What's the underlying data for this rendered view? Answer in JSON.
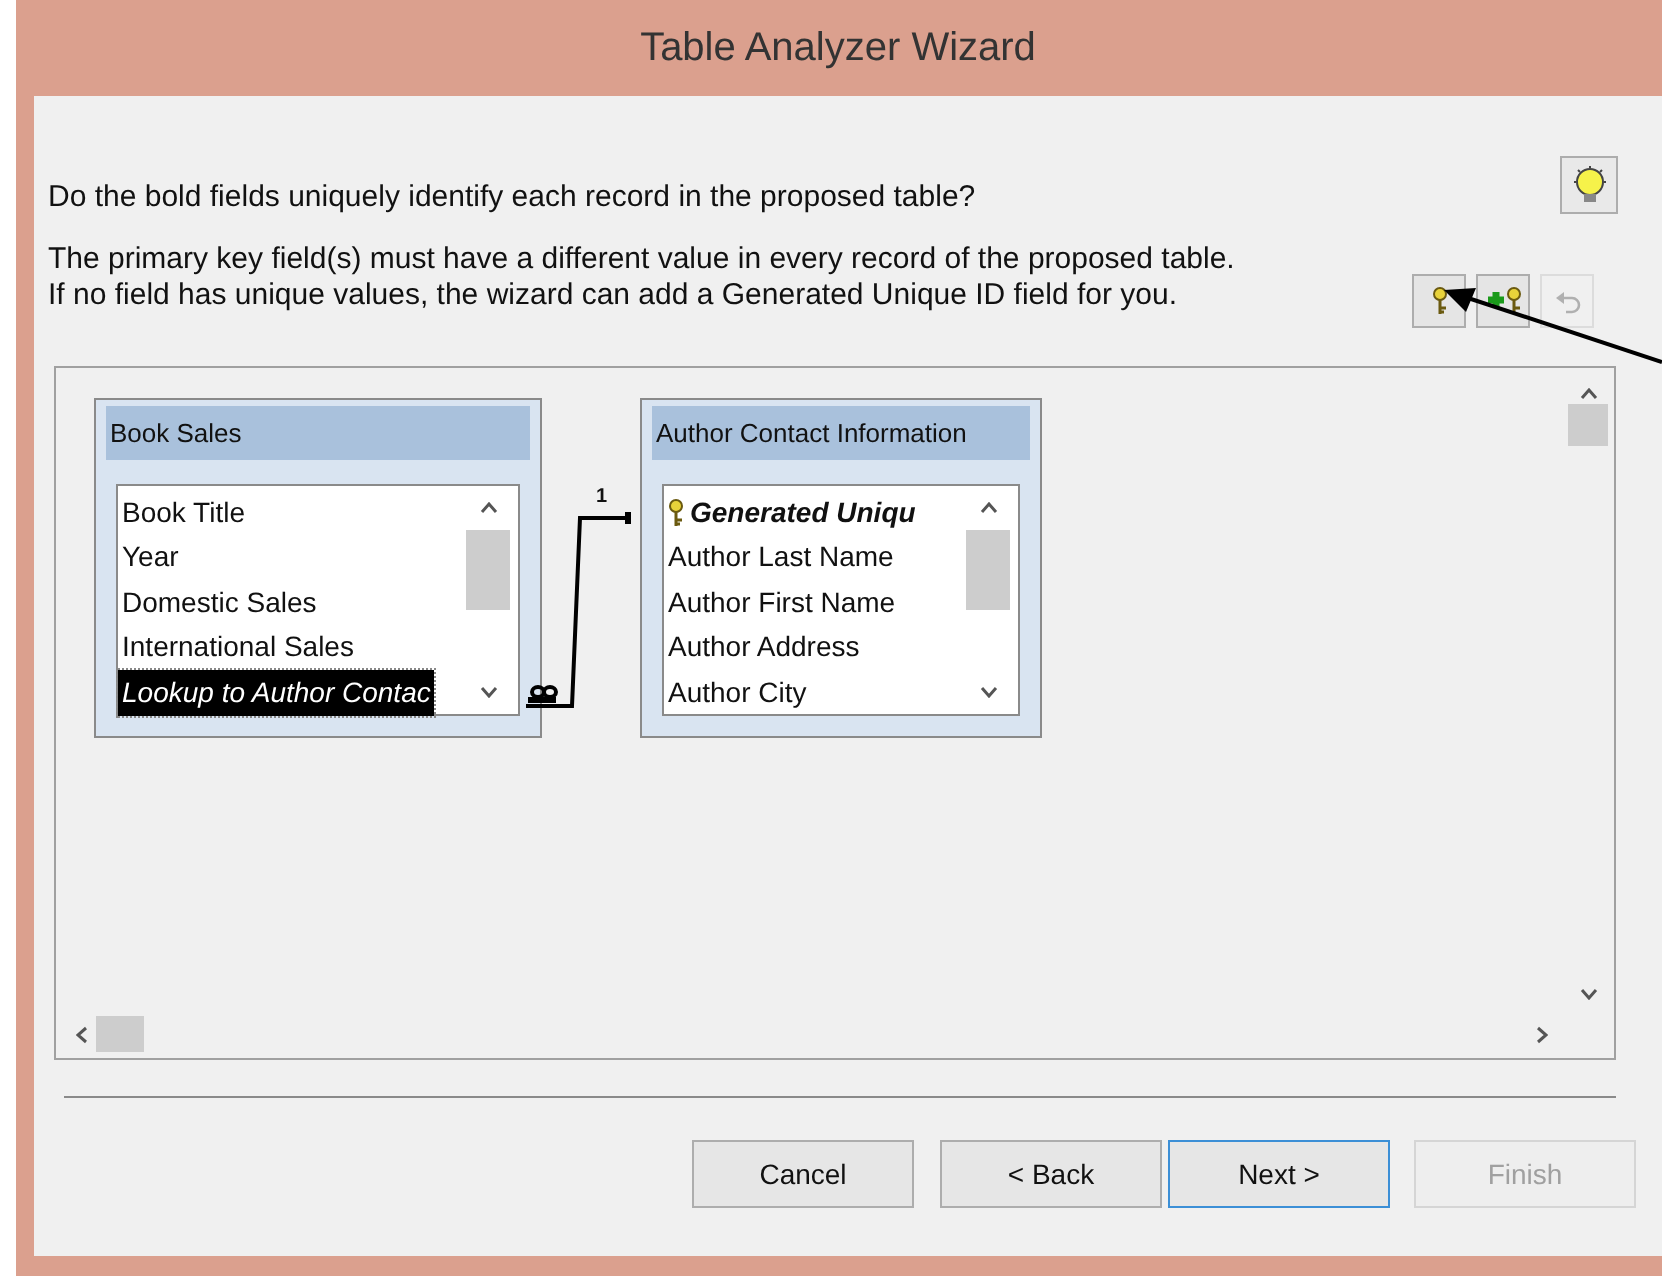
{
  "window": {
    "title": "Table Analyzer Wizard"
  },
  "prompt": {
    "question": "Do the bold fields uniquely identify each record in the proposed table?",
    "explanation": [
      "The primary key field(s) must have a different value in every record of the proposed table.",
      "If no field has unique values, the wizard can add a Generated Unique ID field for you."
    ]
  },
  "toolbar": [
    {
      "kind": "key",
      "disabled": false
    },
    {
      "kind": "add_key",
      "disabled": false
    },
    {
      "kind": "undo",
      "disabled": true
    }
  ],
  "tables": [
    {
      "title": "Book Sales",
      "fields": [
        {
          "name": "Book Title",
          "kind": "field",
          "selected": false
        },
        {
          "name": "Year",
          "kind": "field",
          "selected": false
        },
        {
          "name": "Domestic Sales",
          "kind": "field",
          "selected": false
        },
        {
          "name": "International Sales",
          "kind": "field",
          "selected": false
        },
        {
          "name": "Lookup to Author Contac",
          "kind": "lookup",
          "selected": true
        }
      ]
    },
    {
      "title": "Author Contact Information",
      "fields": [
        {
          "name": "Generated Uniqu",
          "kind": "key",
          "selected": false
        },
        {
          "name": "Author Last Name",
          "kind": "field",
          "selected": false
        },
        {
          "name": "Author First Name",
          "kind": "field",
          "selected": false
        },
        {
          "name": "Author Address",
          "kind": "field",
          "selected": false
        },
        {
          "name": "Author City",
          "kind": "field",
          "selected": false
        }
      ]
    }
  ],
  "relationship": {
    "one_label": "1"
  },
  "buttons": [
    {
      "label": "Cancel",
      "default": false,
      "disabled": false
    },
    {
      "label": "< Back",
      "default": false,
      "disabled": false
    },
    {
      "label": "Next >",
      "default": true,
      "disabled": false
    },
    {
      "label": "Finish",
      "default": false,
      "disabled": true
    }
  ]
}
